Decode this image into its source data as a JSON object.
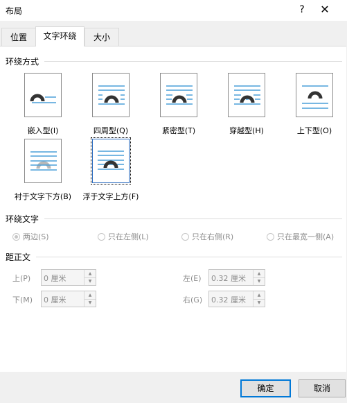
{
  "dialog": {
    "title": "布局",
    "help_glyph": "?",
    "close_glyph": "✕"
  },
  "tabs": [
    {
      "label": "位置"
    },
    {
      "label": "文字环绕"
    },
    {
      "label": "大小"
    }
  ],
  "wrap_style": {
    "section_title": "环绕方式",
    "options": [
      {
        "label": "嵌入型(I)",
        "icon": "inline-icon"
      },
      {
        "label": "四周型(Q)",
        "icon": "square-icon"
      },
      {
        "label": "紧密型(T)",
        "icon": "tight-icon"
      },
      {
        "label": "穿越型(H)",
        "icon": "through-icon"
      },
      {
        "label": "上下型(O)",
        "icon": "top-bottom-icon"
      },
      {
        "label": "衬于文字下方(B)",
        "icon": "behind-text-icon"
      },
      {
        "label": "浮于文字上方(F)",
        "icon": "in-front-of-text-icon",
        "selected": true
      }
    ]
  },
  "wrap_text": {
    "section_title": "环绕文字",
    "options": [
      {
        "label": "两边(S)",
        "checked": true
      },
      {
        "label": "只在左侧(L)"
      },
      {
        "label": "只在右侧(R)"
      },
      {
        "label": "只在最宽一侧(A)"
      }
    ]
  },
  "distance": {
    "section_title": "距正文",
    "top": {
      "label": "上(P)",
      "value": "0 厘米"
    },
    "bottom": {
      "label": "下(M)",
      "value": "0 厘米"
    },
    "left": {
      "label": "左(E)",
      "value": "0.32 厘米"
    },
    "right": {
      "label": "右(G)",
      "value": "0.32 厘米"
    }
  },
  "buttons": {
    "ok": "确定",
    "cancel": "取消"
  },
  "colors": {
    "line": "#4a9fd8",
    "shape": "#333333",
    "selected_border": "#2b6bbf",
    "ok_border": "#0078d7"
  }
}
